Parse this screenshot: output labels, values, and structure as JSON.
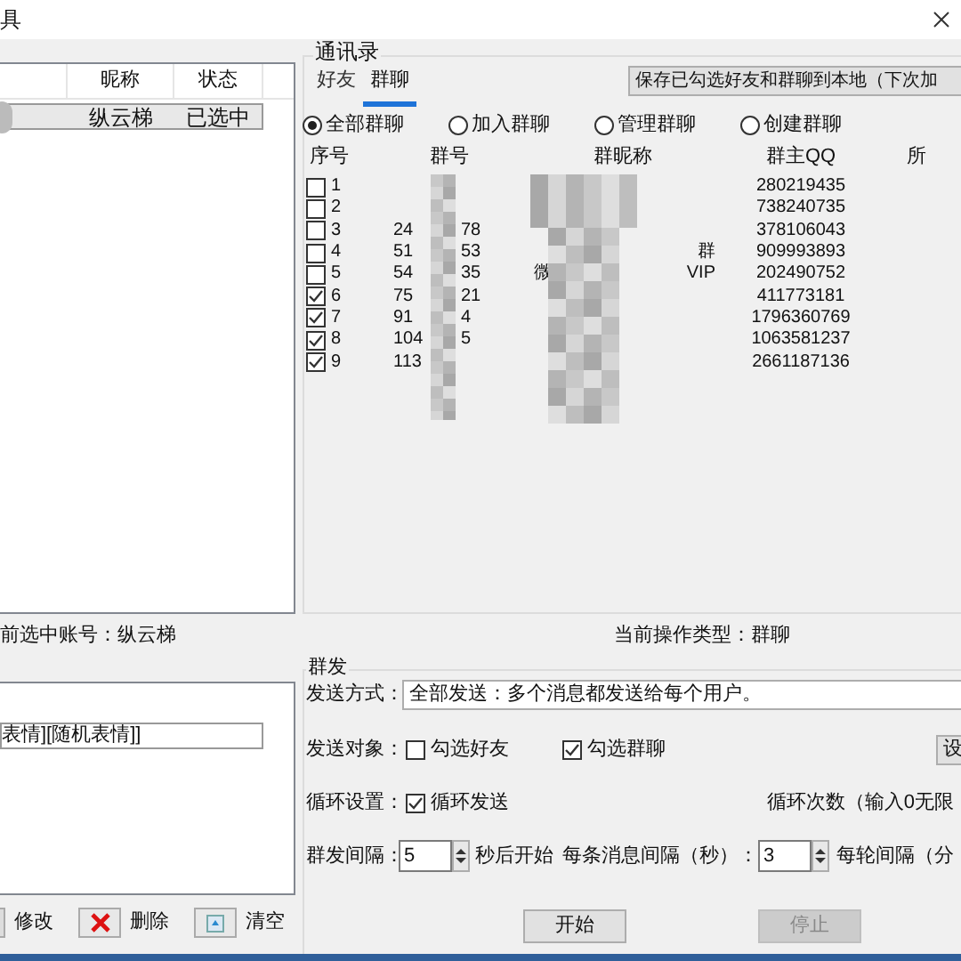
{
  "window": {
    "title": "具"
  },
  "accounts": {
    "columns": [
      "昵称",
      "状态"
    ],
    "rows": [
      {
        "nickname": "纵云梯",
        "status": "已选中",
        "selected": true
      }
    ]
  },
  "contacts": {
    "title": "通讯录",
    "tabs": [
      {
        "label": "好友",
        "selected": false
      },
      {
        "label": "群聊",
        "selected": true
      }
    ],
    "save_button": "保存已勾选好友和群聊到本地（下次加",
    "filters": [
      {
        "label": "全部群聊",
        "selected": true
      },
      {
        "label": "加入群聊",
        "selected": false
      },
      {
        "label": "管理群聊",
        "selected": false
      },
      {
        "label": "创建群聊",
        "selected": false
      }
    ],
    "columns": [
      "序号",
      "群号",
      "群昵称",
      "群主QQ",
      "所"
    ],
    "rows": [
      {
        "index": "1",
        "checked": false,
        "owner_qq": "280219435"
      },
      {
        "index": "2",
        "checked": false,
        "owner_qq": "738240735"
      },
      {
        "index": "3",
        "checked": false,
        "group_no_start": "24",
        "group_no_end": "78",
        "owner_qq": "378106043"
      },
      {
        "index": "4",
        "checked": false,
        "group_no_start": "51",
        "group_no_end": "53",
        "name_end": "群",
        "owner_qq": "909993893"
      },
      {
        "index": "5",
        "checked": false,
        "group_no_start": "54",
        "group_no_end": "35",
        "name_start": "微",
        "name_end": "VIP",
        "owner_qq": "202490752"
      },
      {
        "index": "6",
        "checked": true,
        "group_no_start": "75",
        "group_no_end": "21",
        "owner_qq": "411773181"
      },
      {
        "index": "7",
        "checked": true,
        "group_no_start": "91",
        "group_no_end": "4",
        "owner_qq": "1796360769"
      },
      {
        "index": "8",
        "checked": true,
        "group_no_start": "104",
        "group_no_end": "5",
        "owner_qq": "1063581237"
      },
      {
        "index": "9",
        "checked": true,
        "group_no_start": "113",
        "owner_qq": "2661187136"
      }
    ]
  },
  "selected_account": "前选中账号：纵云梯",
  "operation_type": "当前操作类型：群聊",
  "messages": {
    "items": [
      "表情][随机表情]]"
    ],
    "buttons": [
      {
        "kind": "edit",
        "label": "修改"
      },
      {
        "kind": "delete",
        "label": "删除"
      },
      {
        "kind": "clear",
        "label": "清空"
      }
    ]
  },
  "broadcast": {
    "title": "群发",
    "send_mode_label": "发送方式：",
    "send_mode": "全部发送：多个消息都发送给每个用户。",
    "target_label": "发送对象：",
    "targets": [
      {
        "label": "勾选好友",
        "checked": false
      },
      {
        "label": "勾选群聊",
        "checked": true
      }
    ],
    "settings_button": "设",
    "loop_label": "循环设置：",
    "loop": {
      "label": "循环发送",
      "checked": true
    },
    "loop_count_label": "循环次数（输入0无限",
    "interval_label": "群发间隔：",
    "start_delay": "5",
    "start_delay_suffix": "秒后开始",
    "message_interval_label": "每条消息间隔（秒）：",
    "message_interval": "3",
    "round_interval_label": "每轮间隔（分",
    "actions": [
      {
        "label": "开始",
        "disabled": false
      },
      {
        "label": "停止",
        "disabled": true
      }
    ]
  }
}
